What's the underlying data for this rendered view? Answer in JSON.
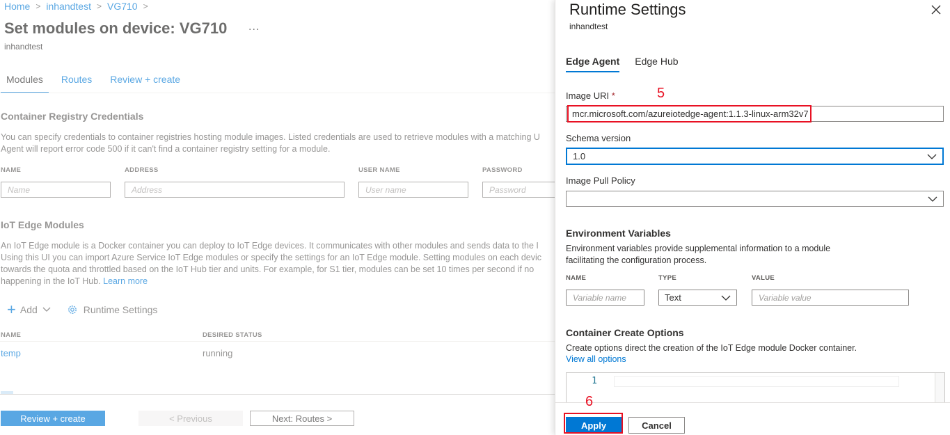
{
  "breadcrumb": [
    "Home",
    "inhandtest",
    "VG710"
  ],
  "page": {
    "title": "Set modules on device: VG710",
    "more": "...",
    "subtitle": "inhandtest"
  },
  "tabs": [
    "Modules",
    "Routes",
    "Review + create"
  ],
  "registry": {
    "heading": "Container Registry Credentials",
    "desc_line1": "You can specify credentials to container registries hosting module images. Listed credentials are used to retrieve modules with a matching U",
    "desc_line2": "Agent will report error code 500 if it can't find a container registry setting for a module.",
    "columns": [
      "NAME",
      "ADDRESS",
      "USER NAME",
      "PASSWORD"
    ],
    "placeholders": [
      "Name",
      "Address",
      "User name",
      "Password"
    ]
  },
  "modules": {
    "heading": "IoT Edge Modules",
    "desc_line1": "An IoT Edge module is a Docker container you can deploy to IoT Edge devices. It communicates with other modules and sends data to the I",
    "desc_line2": "Using this UI you can import Azure Service IoT Edge modules or specify the settings for an IoT Edge module. Setting modules on each devic",
    "desc_line3": "towards the quota and throttled based on the IoT Hub tier and units. For example, for S1 tier, modules can be set 10 times per second if no",
    "desc_line4": "happening in the IoT Hub.",
    "learn_more": "Learn more",
    "add_label": "Add",
    "runtime_label": "Runtime Settings",
    "columns": [
      "NAME",
      "DESIRED STATUS"
    ],
    "rows": [
      {
        "name": "temp",
        "status": "running"
      }
    ]
  },
  "footer": {
    "review": "Review + create",
    "previous": "< Previous",
    "next": "Next: Routes >"
  },
  "panel": {
    "title": "Runtime Settings",
    "subtitle": "inhandtest",
    "tabs": [
      "Edge Agent",
      "Edge Hub"
    ],
    "image_uri_label": "Image URI",
    "required_mark": "*",
    "image_uri_value": "mcr.microsoft.com/azureiotedge-agent:1.1.3-linux-arm32v7",
    "schema_label": "Schema version",
    "schema_value": "1.0",
    "pull_policy_label": "Image Pull Policy",
    "pull_policy_value": "",
    "env_heading": "Environment Variables",
    "env_desc_line1": "Environment variables provide supplemental information to a module",
    "env_desc_line2": "facilitating the configuration process.",
    "env_columns": [
      "NAME",
      "TYPE",
      "VALUE"
    ],
    "env_name_placeholder": "Variable name",
    "env_type_value": "Text",
    "env_value_placeholder": "Variable value",
    "cco_heading": "Container Create Options",
    "cco_desc": "Create options direct the creation of the IoT Edge module Docker container.",
    "cco_link": "View all options",
    "editor_line_number": "1",
    "apply": "Apply",
    "cancel": "Cancel"
  },
  "annotations": {
    "step5": "5",
    "step6": "6"
  },
  "colors": {
    "accent": "#0078d4",
    "annotation": "#e81123"
  }
}
